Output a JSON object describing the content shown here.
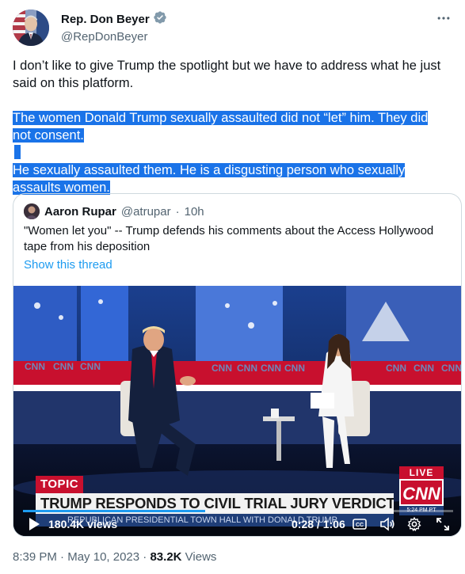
{
  "author": {
    "display_name": "Rep. Don Beyer",
    "handle": "@RepDonBeyer",
    "verified_icon": "verified-badge-icon",
    "more_icon": "more-horizontal-icon"
  },
  "tweet": {
    "intro": "I don’t like to give Trump the spotlight but we have to address what he just said on this platform.",
    "para2_line1": "The women Donald Trump sexually assaulted did not “let” him. They did",
    "para2_line2": "not consent.",
    "para3_line1": "He sexually assaulted them. He is a disgusting person who sexually",
    "para3_line2": "assaults women."
  },
  "quote": {
    "author_name": "Aaron Rupar",
    "author_handle": "@atrupar",
    "separator": "·",
    "age": "10h",
    "text": "\"Women let you\" -- Trump defends his comments about the Access Hollywood tape from his deposition",
    "show_thread": "Show this thread"
  },
  "video": {
    "chyron_topic": "TOPIC",
    "chyron_headline": "TRUMP RESPONDS TO CIVIL TRIAL JURY VERDICT",
    "chyron_sub": "REPUBLICAN PRESIDENTIAL TOWN HALL WITH DONALD TRUMP",
    "live_label": "LIVE",
    "network": "CNN",
    "network_time": "5:24 PM PT",
    "views": "180.4K views",
    "time_current": "0:28",
    "time_sep": " / ",
    "time_total": "1:06",
    "progress_fraction": 0.424,
    "icons": [
      "play-icon",
      "captions-icon",
      "volume-icon",
      "settings-icon",
      "fullscreen-icon"
    ]
  },
  "meta": {
    "time": "8:39 PM",
    "dot": " · ",
    "date": "May 10, 2023",
    "views_count": "83.2K",
    "views_label": "Views"
  },
  "colors": {
    "accent": "#1d9bf0",
    "selection": "#1a73e8",
    "cnn_red": "#c8102e",
    "secondary_text": "#536471"
  }
}
